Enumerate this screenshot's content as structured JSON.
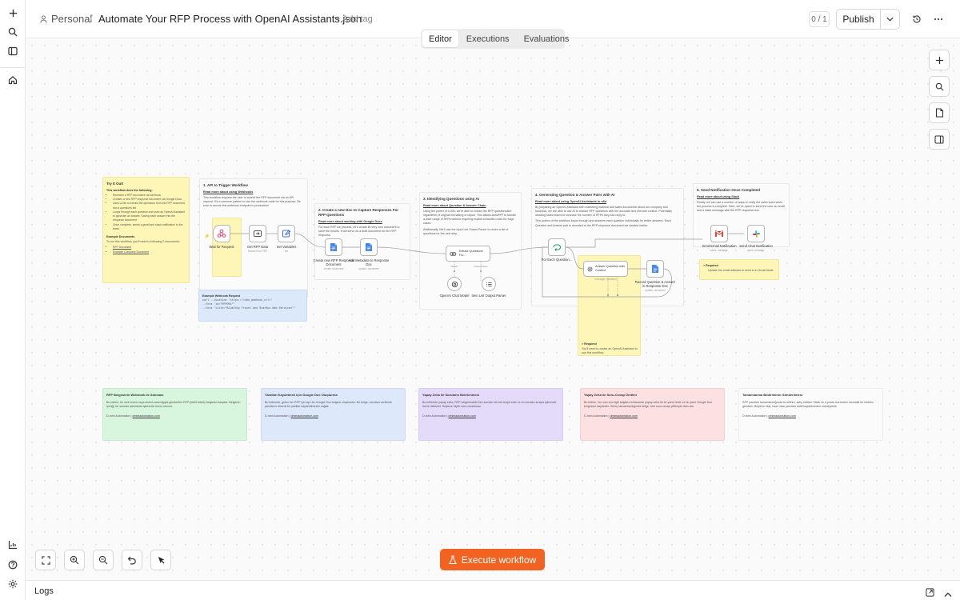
{
  "header": {
    "project": "Personal",
    "workflow_name": "Automate Your RFP Process with OpenAI Assistants.json",
    "add_tag": "+ Add tag",
    "counter": "0 / 1",
    "publish_label": "Publish"
  },
  "tabs": [
    {
      "label": "Editor",
      "active": true
    },
    {
      "label": "Executions",
      "active": false
    },
    {
      "label": "Evaluations",
      "active": false
    }
  ],
  "notes": {
    "try": {
      "title": "Try It Out!",
      "subtitle": "This workflow does the following:",
      "items": [
        "Receives a RFP document via webhook",
        "Creates a new RFP response document via Google Docs",
        "Uses LLMs to extract the questions from the RFP document into a questions list",
        "Loops through each question and uses an OpenAI Assistant to generate an answer. Saving each answer into the response document",
        "Once complete, sends a gmail and slack notification to the team."
      ],
      "examples_title": "Example Documents",
      "examples_text": "To run this workflow, you'll need to following 2 documents:",
      "example_links": [
        "RFP Document",
        "Example Company Document"
      ]
    },
    "api": {
      "title": "1. API to Trigger Workflow",
      "link": "Read more about using Webhooks",
      "text": "This workflow requires the user to submit the RFP document via an API request. It's a common pattern to use the webhook node for this purpose. Be sure to secure this webhook endpoint in production!"
    },
    "doc": {
      "title": "2. Create a new Doc to Capture Responses For RFP Questions",
      "link": "Read more about working with Google Docs",
      "text": "For each RFP we process, let's create its very own document to store the results. It will serve as a draft document for the RFP response."
    },
    "ident": {
      "title": "3. Identifying Questions using AI",
      "link": "Read more about Question & Answer Chain",
      "text1": "Using the power of LLMs, we're able to extract the RFP questionnaire regardless of original formatting or layout. This allows AutoRFP to handle a wide range of RFPs without requiring explicit extraction rules for edge cases.",
      "text2": "Additionally, We'll use the Input List Output Parser to return a list of questions for the next step."
    },
    "gen": {
      "title": "4. Generating Question & Answer Pairs with AI",
      "link": "Read more about using OpenAI Assistants in n8n",
      "text1": "By preparing an OpenAI Assistant with marketing material and sales documents about our company and business, we are able to use AI to answer RFP questions with the accurate and relevant context. Potentially allowing sales teams to increase the number of RFPs they can reply to.",
      "text2": "This portion of the workflow loops through and answers each question individually for better answers. Each Question and Answer pair is recorded to the RFP response document we created earlier."
    },
    "notify": {
      "title": "5. Send Notification Once Completed",
      "link": "Read more about using Slack",
      "text": "Finally, we can use a number of ways to notify the sales team when the process is complete. Here, we've opted to send the user an email and a slack message with the RFP response doc."
    },
    "webhook_example": {
      "title": "Example Webhook Request",
      "lines": [
        "curl --location 'https://<n8n_webhook_url>'",
        "--form 'id=\"RFP001\"'",
        "--form 'title=\"BlueChip Travel and StarBus Web Services\"'"
      ]
    },
    "required_openai": {
      "title": "Required",
      "text": "You'll need to create an OpenAI Assistant to use this workflow."
    },
    "required_email": {
      "title": "Required",
      "text": "Update the email address to send to in Gmail Node."
    }
  },
  "nodes": {
    "wait": {
      "label": "Wait for Request"
    },
    "get_data": {
      "label": "Get RFP Data",
      "sub": "extract from PDF"
    },
    "set_vars": {
      "label": "Set Variables",
      "sub": "set"
    },
    "create_doc": {
      "label": "Create new RFP Response Document",
      "sub": "create: document"
    },
    "add_meta": {
      "label": "Add Metadata to Response Doc",
      "sub": "update: document"
    },
    "extract_q": {
      "label": "Extract Questions Fro...",
      "sub_left": "Model*",
      "sub_right": "Output Parser"
    },
    "chat_model": {
      "label": "OpenAI Chat Model"
    },
    "item_list": {
      "label": "Item List Output Parser"
    },
    "for_each": {
      "label": "For Each Question..."
    },
    "answer": {
      "label": "Answer Question with Context",
      "sub": "message: Assistant"
    },
    "record": {
      "label": "Record Question & Answer in Response Doc",
      "sub": "update: document"
    },
    "send_email": {
      "label": "Send Email Notification",
      "sub": "send: message"
    },
    "send_chat": {
      "label": "Send Chat Notification",
      "sub": "post: message"
    }
  },
  "bottom_notes": [
    {
      "title": "RFP Belgesinin Webhook ile Alınması",
      "text": "Bu bölüm, bir web formu veya sistem aracılığıyla gönderilen RFP (teklif talebi) belgesini karşılar. Belgenin içeriği, bir sonraki adımlarda işlenmek üzere okunur.",
      "footer_prefix": "D-mim Automation | ",
      "footer_link": "dmimautomation.com",
      "color": "#d8f5dd"
    },
    {
      "title": "Yanıtları Kaydetmek için Google Doc Oluşturma",
      "text": "Bu bölümde, gelen her RFP için ayrı bir Google Doc belgesi oluşturulur. Bu belge, sorulara verilecek yanıtların düzenli bir şekilde kaydedilmesini sağlar.",
      "footer_prefix": "D-mim Automation | ",
      "footer_link": "dmimautomation.com",
      "color": "#dde8fb"
    },
    {
      "title": "Yapay Zeka ile Soruların Belirlenmesi",
      "text": "Bu bölümde yapay zeka, RFP belgesindeki tüm soruları tek tek tespit eder ve bu soruları sırayla işlenmek üzere listeleler. Böylece hiçbir soru unutulmaz.",
      "footer_prefix": "D-mim Automation | ",
      "footer_link": "dmimautomation.com",
      "color": "#e4dbfa"
    },
    {
      "title": "Yapay Zeka ile Soru-Cevap Üretimi",
      "text": "Bu bölüm, her soru için ilgili bağlamı kullanarak yapay zeka ile bir yanıt üretir ve bu yanıt Google Doc belgesine kaydeder. Süreç tamamlandığında belge, tüm soru-cevap çiftleriyle dolu olur.",
      "footer_prefix": "D-mim Automation | ",
      "footer_link": "dmimautomation.com",
      "color": "#fde0e2"
    },
    {
      "title": "Tamamlanma Bildiriminin Gönderilmesi",
      "text": "RFP yanıtları tamamlandığında bu bölüm, satış ekibine Slack ve e-posta üzerinden otomatik bir bildirim gönderir. Böylece ekip, hazır olan yanıtları sahit kaydetmeden inceleyebilir.",
      "footer_prefix": "D-mim Automation | ",
      "footer_link": "dmimautomation.com",
      "color": "#fbfbfb"
    }
  ],
  "execute_label": "Execute workflow",
  "logs_label": "Logs",
  "colors": {
    "accent": "#f26321"
  }
}
